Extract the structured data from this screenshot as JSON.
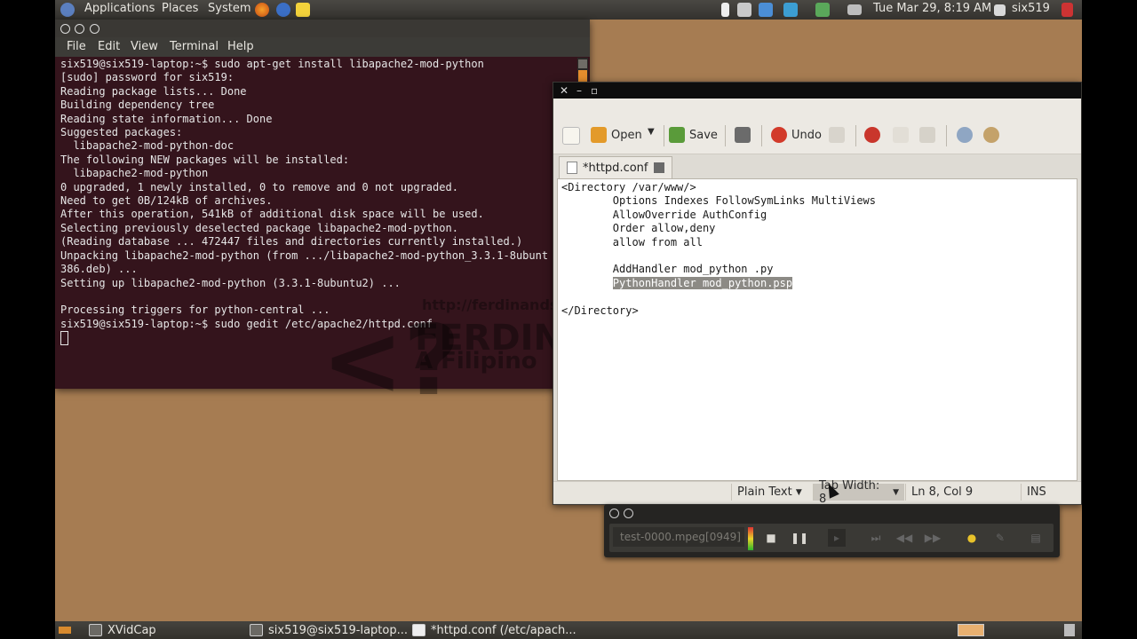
{
  "top_panel": {
    "menus": [
      "Applications",
      "Places",
      "System"
    ],
    "datetime": "Tue Mar 29,  8:19 AM",
    "user": "six519",
    "icons": [
      "ubuntu-logo-icon",
      "firefox-icon",
      "help-icon",
      "notes-icon",
      "battery-icon",
      "chat-icon",
      "dropbox-icon",
      "network-icon",
      "update-icon",
      "mail-icon",
      "user-icon",
      "logout-icon"
    ]
  },
  "terminal": {
    "menu": [
      "File",
      "Edit",
      "View",
      "Terminal",
      "Help"
    ],
    "lines": [
      "six519@six519-laptop:~$ sudo apt-get install libapache2-mod-python",
      "[sudo] password for six519:",
      "Reading package lists... Done",
      "Building dependency tree",
      "Reading state information... Done",
      "Suggested packages:",
      "  libapache2-mod-python-doc",
      "The following NEW packages will be installed:",
      "  libapache2-mod-python",
      "0 upgraded, 1 newly installed, 0 to remove and 0 not upgraded.",
      "Need to get 0B/124kB of archives.",
      "After this operation, 541kB of additional disk space will be used.",
      "Selecting previously deselected package libapache2-mod-python.",
      "(Reading database ... 472447 files and directories currently installed.)",
      "Unpacking libapache2-mod-python (from .../libapache2-mod-python_3.3.1-8ubuntu",
      "386.deb) ...",
      "Setting up libapache2-mod-python (3.3.1-8ubuntu2) ...",
      "",
      "Processing triggers for python-central ...",
      "six519@six519-laptop:~$ sudo gedit /etc/apache2/httpd.conf"
    ]
  },
  "watermark": {
    "url": "http://ferdinandsit",
    "name": "FERDINA",
    "tagline": "A Filipino"
  },
  "gedit": {
    "toolbar": {
      "open": "Open",
      "save": "Save",
      "undo": "Undo"
    },
    "tab_label": "*httpd.conf",
    "code_before": "<Directory /var/www/>\n        Options Indexes FollowSymLinks MultiViews\n        AllowOverride AuthConfig\n        Order allow,deny\n        allow from all\n\n        AddHandler mod_python .py\n        ",
    "code_selected": "PythonHandler mod_python.psp",
    "code_after": "\n\n</Directory>",
    "status": {
      "language": "Plain Text",
      "tab_width": "Tab Width:  8",
      "position": "Ln 8, Col 9",
      "mode": "INS"
    }
  },
  "xvidcap": {
    "filename": "test-0000.mpeg[0949]"
  },
  "taskbar": {
    "tasks": [
      "XVidCap",
      "six519@six519-laptop...",
      "*httpd.conf (/etc/apach..."
    ]
  }
}
